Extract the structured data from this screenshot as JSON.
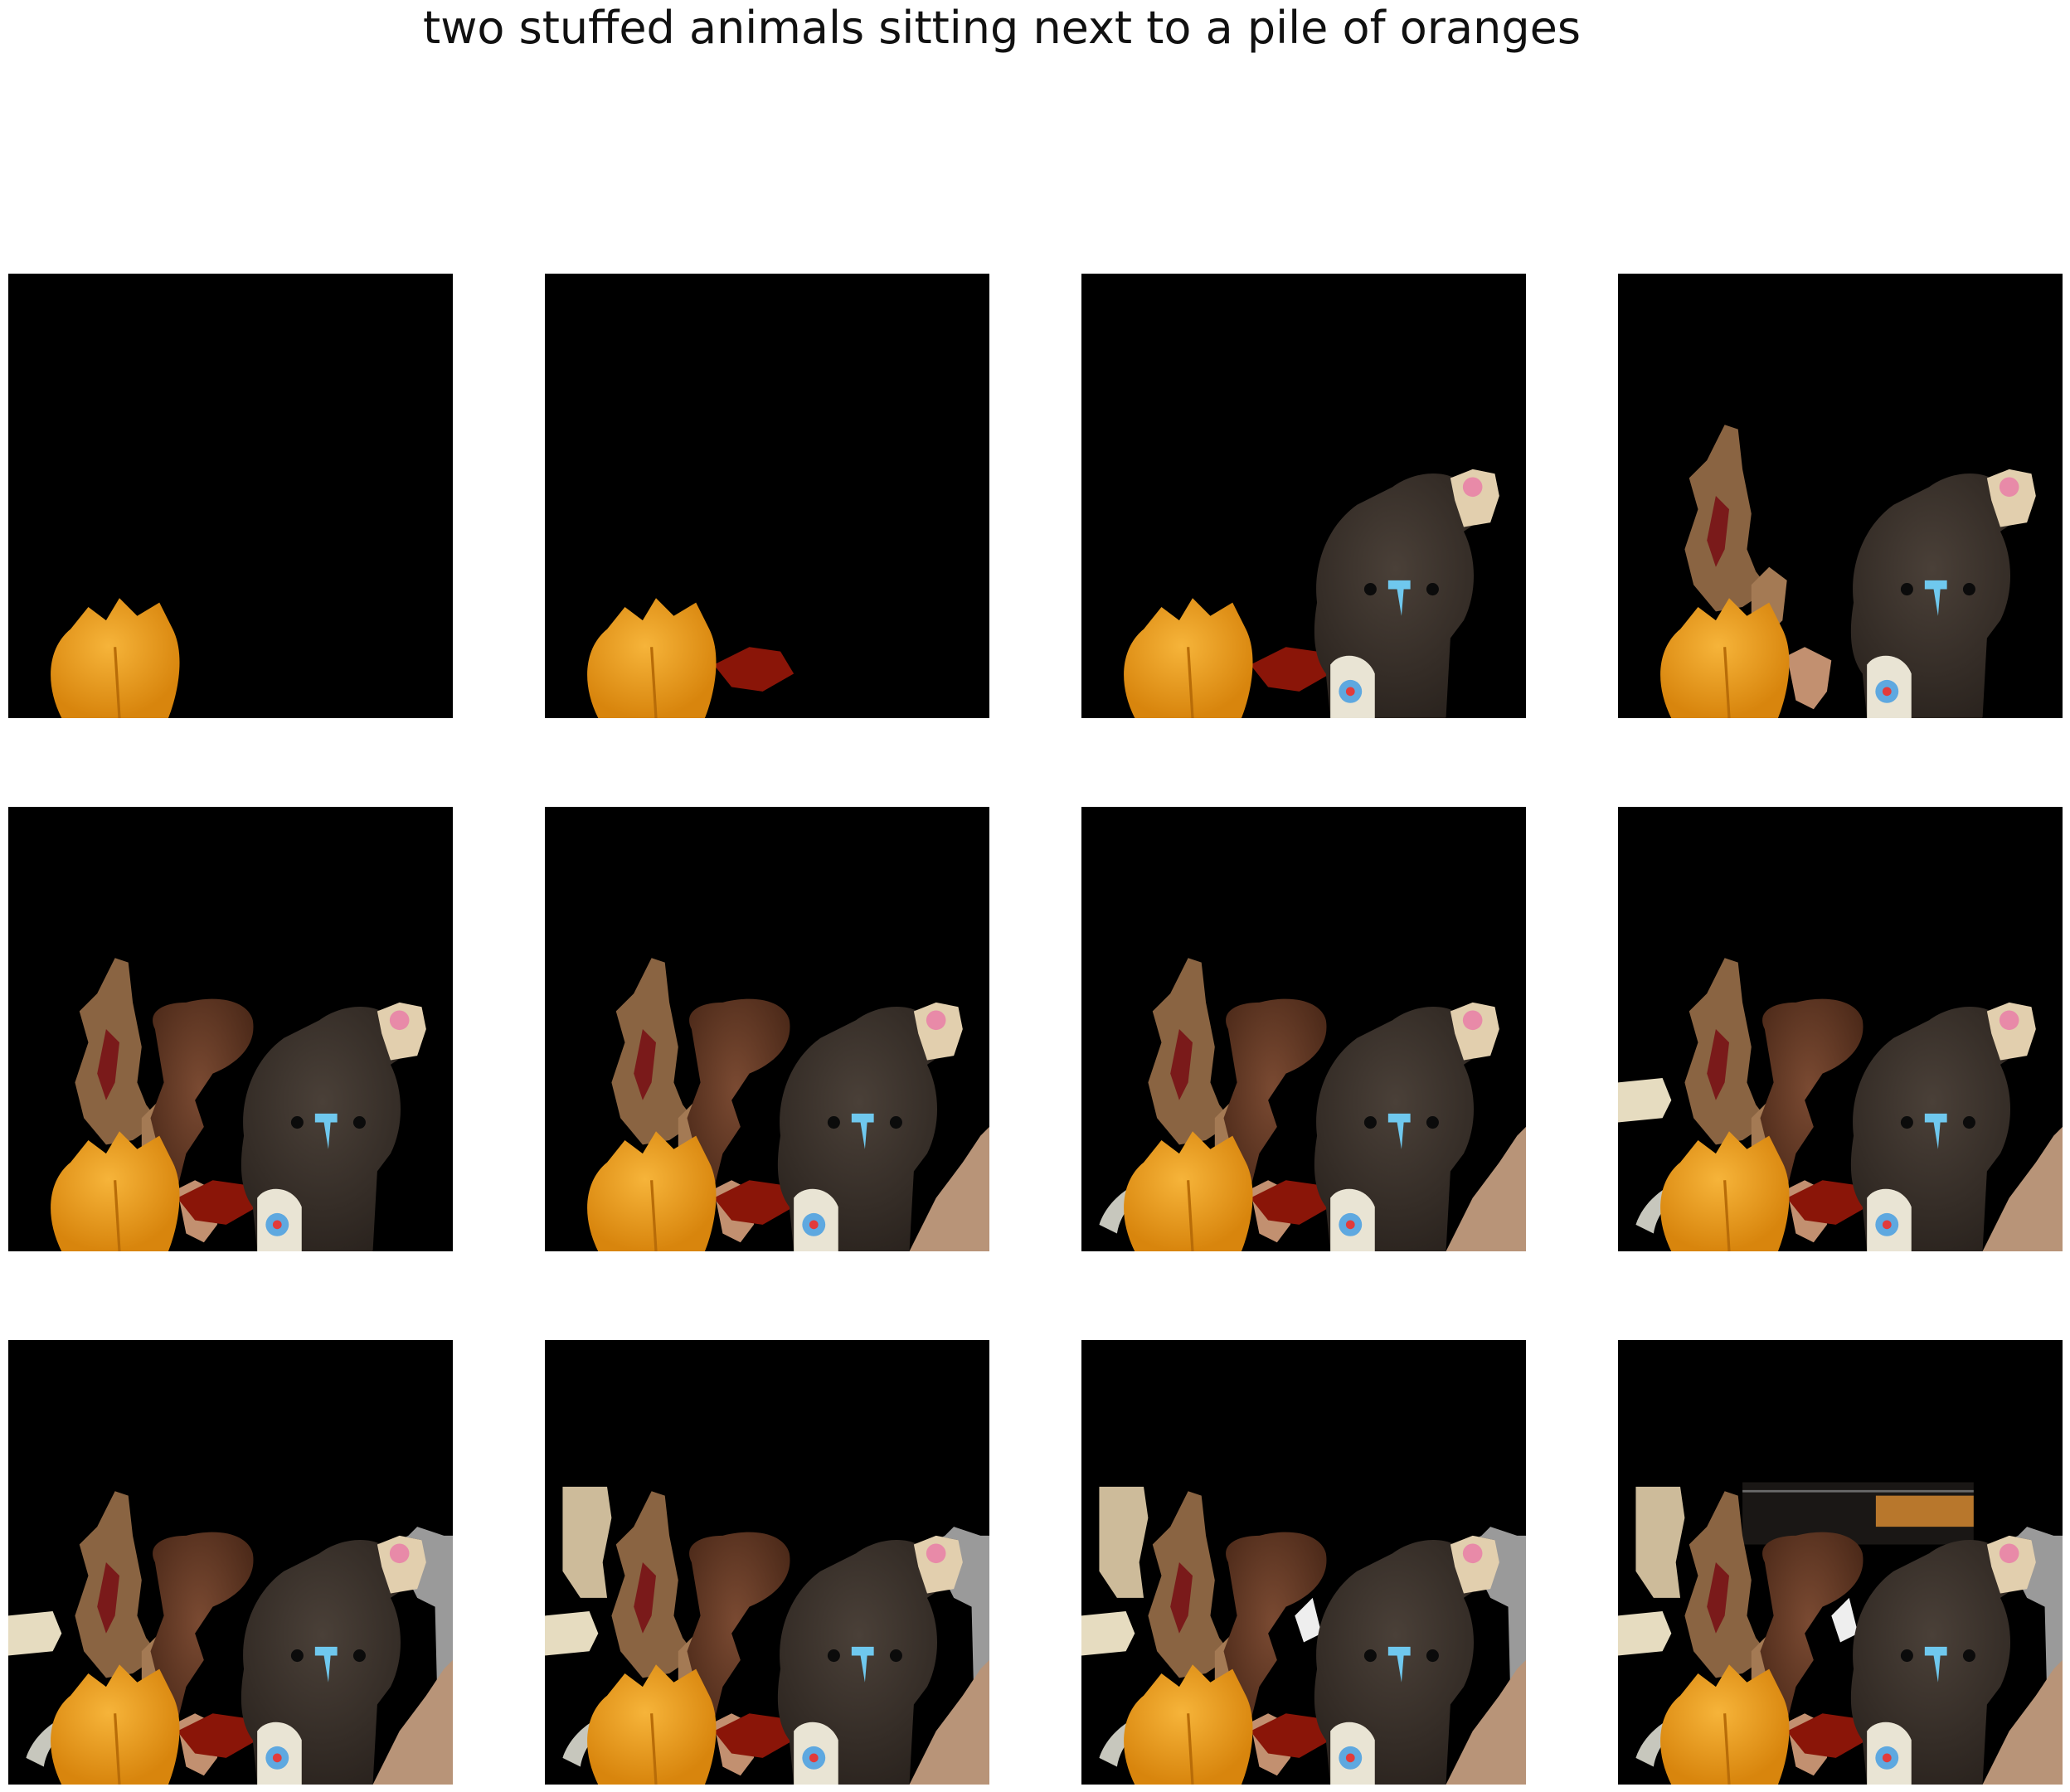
{
  "title": "two stuffed animals sitting next to a pile of oranges",
  "panels": [
    {
      "step": 1,
      "layers": [
        "orange"
      ]
    },
    {
      "step": 2,
      "layers": [
        "orange",
        "red-cloth"
      ]
    },
    {
      "step": 3,
      "layers": [
        "orange",
        "red-cloth",
        "dark-bear"
      ]
    },
    {
      "step": 4,
      "layers": [
        "orange",
        "dark-bear",
        "tan-paper",
        "paper-piece"
      ]
    },
    {
      "step": 5,
      "layers": [
        "orange",
        "red-cloth",
        "dark-bear",
        "tan-paper",
        "brown-bear",
        "paper-piece"
      ]
    },
    {
      "step": 6,
      "layers": [
        "orange",
        "red-cloth",
        "dark-bear",
        "tan-paper",
        "brown-bear",
        "paper-piece",
        "hand"
      ]
    },
    {
      "step": 7,
      "layers": [
        "orange",
        "red-cloth",
        "dark-bear",
        "tan-paper",
        "brown-bear",
        "paper-piece",
        "hand",
        "bag-strap"
      ]
    },
    {
      "step": 8,
      "layers": [
        "orange",
        "red-cloth",
        "dark-bear",
        "tan-paper",
        "brown-bear",
        "paper-piece",
        "hand",
        "bag-strap",
        "table-left"
      ]
    },
    {
      "step": 9,
      "layers": [
        "orange",
        "red-cloth",
        "dark-bear",
        "tan-paper",
        "brown-bear",
        "paper-piece",
        "hand",
        "bag-strap",
        "table-left",
        "shelf-right"
      ]
    },
    {
      "step": 10,
      "layers": [
        "orange",
        "red-cloth",
        "dark-bear",
        "tan-paper",
        "brown-bear",
        "paper-piece",
        "hand",
        "bag-strap",
        "table-left",
        "shelf-right",
        "box-left"
      ]
    },
    {
      "step": 11,
      "layers": [
        "orange",
        "red-cloth",
        "dark-bear",
        "tan-paper",
        "brown-bear",
        "paper-piece",
        "hand",
        "bag-strap",
        "table-left",
        "shelf-right",
        "box-left",
        "white-gap"
      ]
    },
    {
      "step": 12,
      "layers": [
        "orange",
        "red-cloth",
        "dark-bear",
        "tan-paper",
        "brown-bear",
        "paper-piece",
        "hand",
        "bag-strap",
        "table-left",
        "shelf-right",
        "box-left",
        "white-gap",
        "bowl"
      ]
    }
  ]
}
